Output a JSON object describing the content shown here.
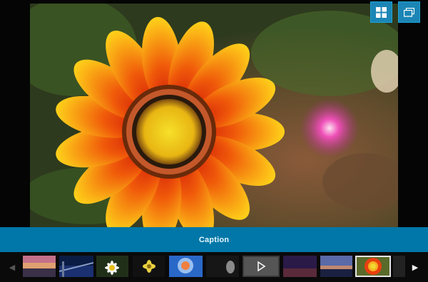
{
  "viewer": {
    "caption": "Caption",
    "toolbar": {
      "grid_icon": "grid-icon",
      "window_icon": "window-icon"
    }
  },
  "thumbnails": [
    {
      "name": "sunset-sea"
    },
    {
      "name": "pier"
    },
    {
      "name": "daisy"
    },
    {
      "name": "yellow-flower"
    },
    {
      "name": "jellyfish"
    },
    {
      "name": "dark-bird"
    },
    {
      "name": "video",
      "is_video": true
    },
    {
      "name": "dusk-sky"
    },
    {
      "name": "evening-coast"
    },
    {
      "name": "gazania-flower",
      "active": true
    },
    {
      "name": "partial"
    }
  ],
  "nav": {
    "prev_icon": "chevron-left-icon",
    "next_icon": "chevron-right-icon"
  }
}
